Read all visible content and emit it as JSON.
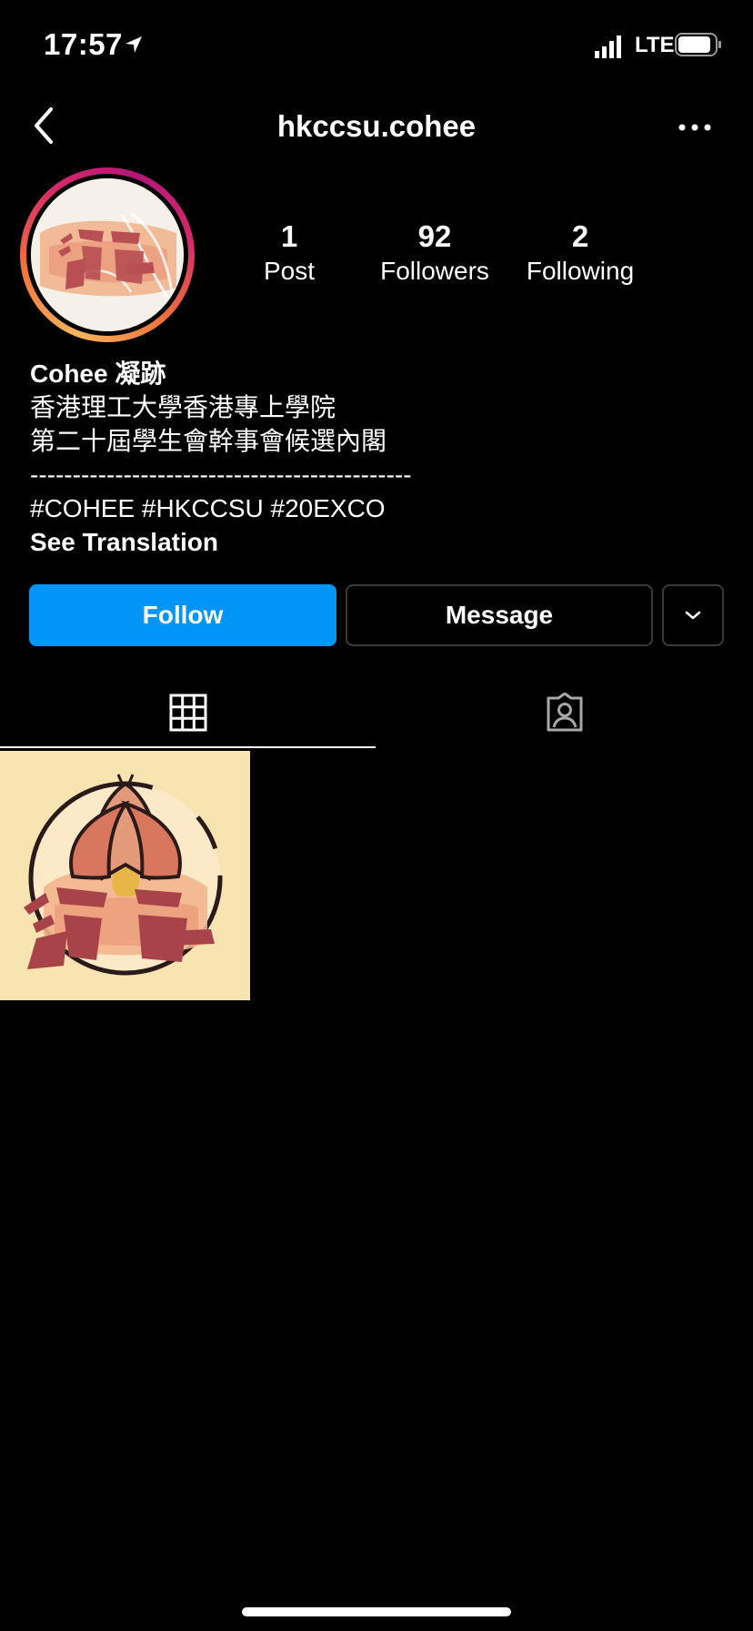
{
  "status_bar": {
    "time": "17:57",
    "network": "LTE"
  },
  "header": {
    "username": "hkccsu.cohee",
    "back_icon": "chevron-left-icon",
    "more_icon": "ellipsis-icon"
  },
  "profile": {
    "stats": {
      "posts": {
        "value": "1",
        "label": "Post"
      },
      "followers": {
        "value": "92",
        "label": "Followers"
      },
      "following": {
        "value": "2",
        "label": "Following"
      }
    },
    "bio": {
      "name": "Cohee 凝跡",
      "line1": "香港理工大學香港專上學院",
      "line2": "第二十屆學生會幹事會候選內閣",
      "divider": "---------------------------------------------",
      "hashtags": "#COHEE #HKCCSU #20EXCO",
      "see_translation": "See Translation"
    }
  },
  "actions": {
    "follow": "Follow",
    "message": "Message"
  },
  "tabs": [
    {
      "name": "grid",
      "icon": "grid-icon",
      "active": true
    },
    {
      "name": "tagged",
      "icon": "tagged-person-icon",
      "active": false
    }
  ],
  "colors": {
    "accent": "#0095f6",
    "background": "#000000",
    "post_bg": "#f8e4b0"
  }
}
